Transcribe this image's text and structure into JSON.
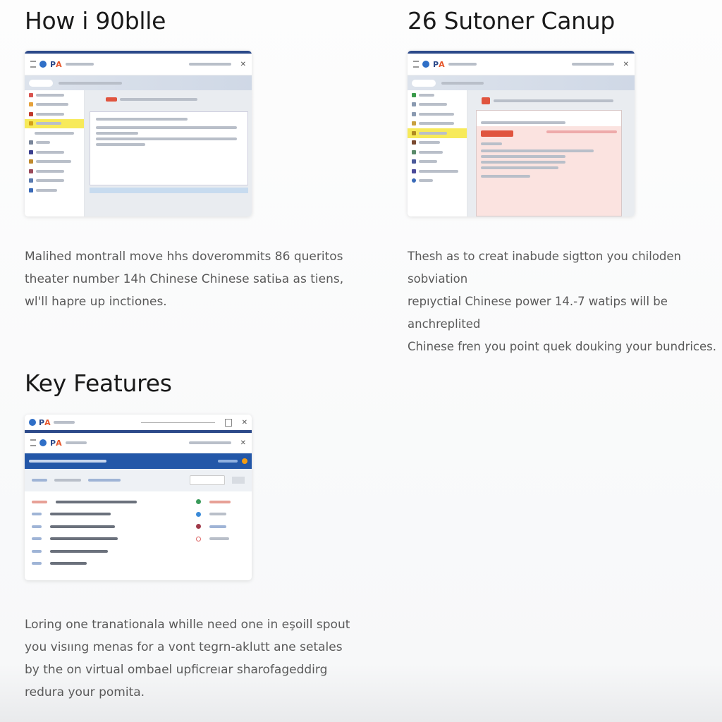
{
  "sections": [
    {
      "title": "How i 90blle",
      "description_lines": [
        "Malihed montrall move hhs doverommits 86 queritos",
        "theater number 14h Chinese Chinese satiьa as tiens,",
        "wl'll hapre up inctiones."
      ]
    },
    {
      "title": "26 Sutoner Canup",
      "description_lines": [
        "Thesh as to creat inabude sigtton you chiloden sobviation",
        "repıyctial Chinese power 14.-7 watips will be anchreplited",
        "Chinese fren you point quek douking your bundrices."
      ]
    },
    {
      "title": "Key Features",
      "description_lines": [
        "Loring one tranationala whille need one in eşoill spout",
        "you visııng menas for a vont tegrn-aklutt ane setales",
        "by the on virtual ombael upficreıar sharofageddirg",
        "redura your pomita."
      ]
    }
  ],
  "screenshot_logo": "PA",
  "colors": {
    "brand_blue": "#2c4a8a",
    "header_blue": "#2357a8",
    "highlight": "#f7ea5a",
    "alert_red": "#e0543e",
    "alert_bg": "#fbe3e0"
  }
}
